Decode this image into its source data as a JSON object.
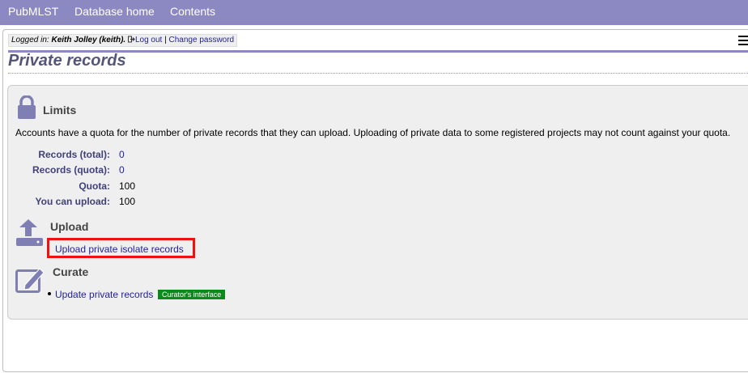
{
  "nav": {
    "items": [
      "PubMLST",
      "Database home",
      "Contents"
    ]
  },
  "login": {
    "prefix": "Logged in:",
    "user": "Keith Jolley (keith).",
    "logout": "Log out",
    "separator": "|",
    "change_password": "Change password"
  },
  "page": {
    "title": "Private records"
  },
  "limits": {
    "heading": "Limits",
    "description": "Accounts have a quota for the number of private records that they can upload. Uploading of private data to some registered projects may not count against your quota.",
    "rows": [
      {
        "label": "Records (total):",
        "value": "0"
      },
      {
        "label": "Records (quota):",
        "value": "0"
      },
      {
        "label": "Quota:",
        "value": "100"
      },
      {
        "label": "You can upload:",
        "value": "100"
      }
    ]
  },
  "upload": {
    "heading": "Upload",
    "link": "Upload private isolate records"
  },
  "curate": {
    "heading": "Curate",
    "link": "Update private records",
    "badge": "Curator's interface"
  },
  "colors": {
    "nav_bg": "#8c89c2",
    "link": "#22229a",
    "highlight": "#ee1111",
    "badge_bg": "#0a8a1a"
  },
  "icons": [
    "lock-icon",
    "upload-icon",
    "edit-icon",
    "logout-icon",
    "hamburger-menu-icon"
  ]
}
